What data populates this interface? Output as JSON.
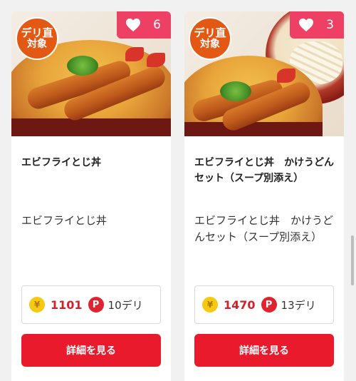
{
  "products": [
    {
      "badge_line1": "デリ直",
      "badge_line2": "対象",
      "likes": "6",
      "title": "エビフライとじ丼",
      "description": "エビフライとじ丼",
      "price": "1101",
      "points": "10デリ",
      "button_label": "詳細を見る"
    },
    {
      "badge_line1": "デリ直",
      "badge_line2": "対象",
      "likes": "3",
      "title": "エビフライとじ丼　かけうどんセット（スープ別添え）",
      "description": "エビフライとじ丼　かけうどんセット（スープ別添え）",
      "price": "1470",
      "points": "13デリ",
      "button_label": "詳細を見る"
    }
  ],
  "icons": {
    "like": "heart-icon",
    "price": "yen-coin-icon",
    "points": "p-point-icon"
  },
  "colors": {
    "badge": "#e35813",
    "likes": "#ee3f65",
    "button": "#e81a2c",
    "price": "#d61f2c"
  }
}
